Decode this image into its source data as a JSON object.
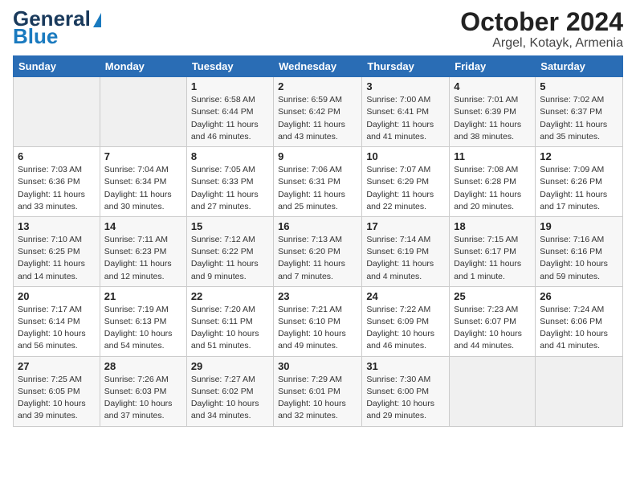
{
  "header": {
    "logo_line1": "General",
    "logo_line2": "Blue",
    "title": "October 2024",
    "subtitle": "Argel, Kotayk, Armenia"
  },
  "calendar": {
    "days_of_week": [
      "Sunday",
      "Monday",
      "Tuesday",
      "Wednesday",
      "Thursday",
      "Friday",
      "Saturday"
    ],
    "weeks": [
      [
        {
          "day": "",
          "info": ""
        },
        {
          "day": "",
          "info": ""
        },
        {
          "day": "1",
          "info": "Sunrise: 6:58 AM\nSunset: 6:44 PM\nDaylight: 11 hours and 46 minutes."
        },
        {
          "day": "2",
          "info": "Sunrise: 6:59 AM\nSunset: 6:42 PM\nDaylight: 11 hours and 43 minutes."
        },
        {
          "day": "3",
          "info": "Sunrise: 7:00 AM\nSunset: 6:41 PM\nDaylight: 11 hours and 41 minutes."
        },
        {
          "day": "4",
          "info": "Sunrise: 7:01 AM\nSunset: 6:39 PM\nDaylight: 11 hours and 38 minutes."
        },
        {
          "day": "5",
          "info": "Sunrise: 7:02 AM\nSunset: 6:37 PM\nDaylight: 11 hours and 35 minutes."
        }
      ],
      [
        {
          "day": "6",
          "info": "Sunrise: 7:03 AM\nSunset: 6:36 PM\nDaylight: 11 hours and 33 minutes."
        },
        {
          "day": "7",
          "info": "Sunrise: 7:04 AM\nSunset: 6:34 PM\nDaylight: 11 hours and 30 minutes."
        },
        {
          "day": "8",
          "info": "Sunrise: 7:05 AM\nSunset: 6:33 PM\nDaylight: 11 hours and 27 minutes."
        },
        {
          "day": "9",
          "info": "Sunrise: 7:06 AM\nSunset: 6:31 PM\nDaylight: 11 hours and 25 minutes."
        },
        {
          "day": "10",
          "info": "Sunrise: 7:07 AM\nSunset: 6:29 PM\nDaylight: 11 hours and 22 minutes."
        },
        {
          "day": "11",
          "info": "Sunrise: 7:08 AM\nSunset: 6:28 PM\nDaylight: 11 hours and 20 minutes."
        },
        {
          "day": "12",
          "info": "Sunrise: 7:09 AM\nSunset: 6:26 PM\nDaylight: 11 hours and 17 minutes."
        }
      ],
      [
        {
          "day": "13",
          "info": "Sunrise: 7:10 AM\nSunset: 6:25 PM\nDaylight: 11 hours and 14 minutes."
        },
        {
          "day": "14",
          "info": "Sunrise: 7:11 AM\nSunset: 6:23 PM\nDaylight: 11 hours and 12 minutes."
        },
        {
          "day": "15",
          "info": "Sunrise: 7:12 AM\nSunset: 6:22 PM\nDaylight: 11 hours and 9 minutes."
        },
        {
          "day": "16",
          "info": "Sunrise: 7:13 AM\nSunset: 6:20 PM\nDaylight: 11 hours and 7 minutes."
        },
        {
          "day": "17",
          "info": "Sunrise: 7:14 AM\nSunset: 6:19 PM\nDaylight: 11 hours and 4 minutes."
        },
        {
          "day": "18",
          "info": "Sunrise: 7:15 AM\nSunset: 6:17 PM\nDaylight: 11 hours and 1 minute."
        },
        {
          "day": "19",
          "info": "Sunrise: 7:16 AM\nSunset: 6:16 PM\nDaylight: 10 hours and 59 minutes."
        }
      ],
      [
        {
          "day": "20",
          "info": "Sunrise: 7:17 AM\nSunset: 6:14 PM\nDaylight: 10 hours and 56 minutes."
        },
        {
          "day": "21",
          "info": "Sunrise: 7:19 AM\nSunset: 6:13 PM\nDaylight: 10 hours and 54 minutes."
        },
        {
          "day": "22",
          "info": "Sunrise: 7:20 AM\nSunset: 6:11 PM\nDaylight: 10 hours and 51 minutes."
        },
        {
          "day": "23",
          "info": "Sunrise: 7:21 AM\nSunset: 6:10 PM\nDaylight: 10 hours and 49 minutes."
        },
        {
          "day": "24",
          "info": "Sunrise: 7:22 AM\nSunset: 6:09 PM\nDaylight: 10 hours and 46 minutes."
        },
        {
          "day": "25",
          "info": "Sunrise: 7:23 AM\nSunset: 6:07 PM\nDaylight: 10 hours and 44 minutes."
        },
        {
          "day": "26",
          "info": "Sunrise: 7:24 AM\nSunset: 6:06 PM\nDaylight: 10 hours and 41 minutes."
        }
      ],
      [
        {
          "day": "27",
          "info": "Sunrise: 7:25 AM\nSunset: 6:05 PM\nDaylight: 10 hours and 39 minutes."
        },
        {
          "day": "28",
          "info": "Sunrise: 7:26 AM\nSunset: 6:03 PM\nDaylight: 10 hours and 37 minutes."
        },
        {
          "day": "29",
          "info": "Sunrise: 7:27 AM\nSunset: 6:02 PM\nDaylight: 10 hours and 34 minutes."
        },
        {
          "day": "30",
          "info": "Sunrise: 7:29 AM\nSunset: 6:01 PM\nDaylight: 10 hours and 32 minutes."
        },
        {
          "day": "31",
          "info": "Sunrise: 7:30 AM\nSunset: 6:00 PM\nDaylight: 10 hours and 29 minutes."
        },
        {
          "day": "",
          "info": ""
        },
        {
          "day": "",
          "info": ""
        }
      ]
    ]
  }
}
